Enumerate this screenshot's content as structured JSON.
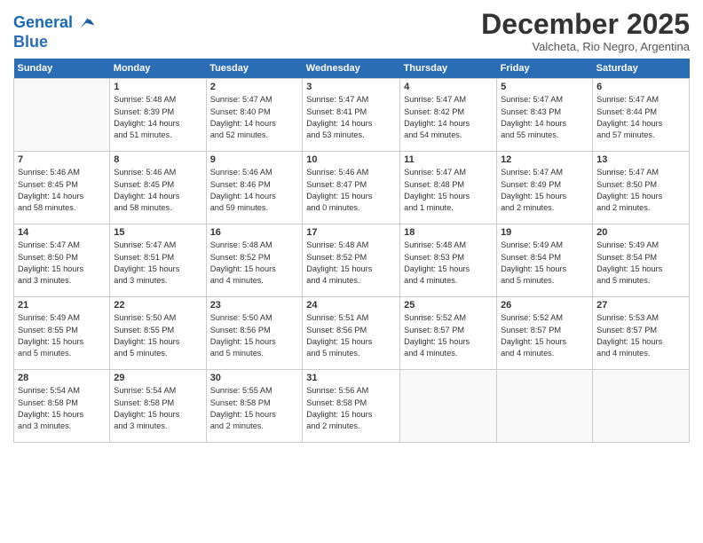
{
  "header": {
    "logo_line1": "General",
    "logo_line2": "Blue",
    "month_year": "December 2025",
    "location": "Valcheta, Rio Negro, Argentina"
  },
  "weekdays": [
    "Sunday",
    "Monday",
    "Tuesday",
    "Wednesday",
    "Thursday",
    "Friday",
    "Saturday"
  ],
  "weeks": [
    [
      {
        "day": "",
        "info": ""
      },
      {
        "day": "1",
        "info": "Sunrise: 5:48 AM\nSunset: 8:39 PM\nDaylight: 14 hours\nand 51 minutes."
      },
      {
        "day": "2",
        "info": "Sunrise: 5:47 AM\nSunset: 8:40 PM\nDaylight: 14 hours\nand 52 minutes."
      },
      {
        "day": "3",
        "info": "Sunrise: 5:47 AM\nSunset: 8:41 PM\nDaylight: 14 hours\nand 53 minutes."
      },
      {
        "day": "4",
        "info": "Sunrise: 5:47 AM\nSunset: 8:42 PM\nDaylight: 14 hours\nand 54 minutes."
      },
      {
        "day": "5",
        "info": "Sunrise: 5:47 AM\nSunset: 8:43 PM\nDaylight: 14 hours\nand 55 minutes."
      },
      {
        "day": "6",
        "info": "Sunrise: 5:47 AM\nSunset: 8:44 PM\nDaylight: 14 hours\nand 57 minutes."
      }
    ],
    [
      {
        "day": "7",
        "info": "Sunrise: 5:46 AM\nSunset: 8:45 PM\nDaylight: 14 hours\nand 58 minutes."
      },
      {
        "day": "8",
        "info": "Sunrise: 5:46 AM\nSunset: 8:45 PM\nDaylight: 14 hours\nand 58 minutes."
      },
      {
        "day": "9",
        "info": "Sunrise: 5:46 AM\nSunset: 8:46 PM\nDaylight: 14 hours\nand 59 minutes."
      },
      {
        "day": "10",
        "info": "Sunrise: 5:46 AM\nSunset: 8:47 PM\nDaylight: 15 hours\nand 0 minutes."
      },
      {
        "day": "11",
        "info": "Sunrise: 5:47 AM\nSunset: 8:48 PM\nDaylight: 15 hours\nand 1 minute."
      },
      {
        "day": "12",
        "info": "Sunrise: 5:47 AM\nSunset: 8:49 PM\nDaylight: 15 hours\nand 2 minutes."
      },
      {
        "day": "13",
        "info": "Sunrise: 5:47 AM\nSunset: 8:50 PM\nDaylight: 15 hours\nand 2 minutes."
      }
    ],
    [
      {
        "day": "14",
        "info": "Sunrise: 5:47 AM\nSunset: 8:50 PM\nDaylight: 15 hours\nand 3 minutes."
      },
      {
        "day": "15",
        "info": "Sunrise: 5:47 AM\nSunset: 8:51 PM\nDaylight: 15 hours\nand 3 minutes."
      },
      {
        "day": "16",
        "info": "Sunrise: 5:48 AM\nSunset: 8:52 PM\nDaylight: 15 hours\nand 4 minutes."
      },
      {
        "day": "17",
        "info": "Sunrise: 5:48 AM\nSunset: 8:52 PM\nDaylight: 15 hours\nand 4 minutes."
      },
      {
        "day": "18",
        "info": "Sunrise: 5:48 AM\nSunset: 8:53 PM\nDaylight: 15 hours\nand 4 minutes."
      },
      {
        "day": "19",
        "info": "Sunrise: 5:49 AM\nSunset: 8:54 PM\nDaylight: 15 hours\nand 5 minutes."
      },
      {
        "day": "20",
        "info": "Sunrise: 5:49 AM\nSunset: 8:54 PM\nDaylight: 15 hours\nand 5 minutes."
      }
    ],
    [
      {
        "day": "21",
        "info": "Sunrise: 5:49 AM\nSunset: 8:55 PM\nDaylight: 15 hours\nand 5 minutes."
      },
      {
        "day": "22",
        "info": "Sunrise: 5:50 AM\nSunset: 8:55 PM\nDaylight: 15 hours\nand 5 minutes."
      },
      {
        "day": "23",
        "info": "Sunrise: 5:50 AM\nSunset: 8:56 PM\nDaylight: 15 hours\nand 5 minutes."
      },
      {
        "day": "24",
        "info": "Sunrise: 5:51 AM\nSunset: 8:56 PM\nDaylight: 15 hours\nand 5 minutes."
      },
      {
        "day": "25",
        "info": "Sunrise: 5:52 AM\nSunset: 8:57 PM\nDaylight: 15 hours\nand 4 minutes."
      },
      {
        "day": "26",
        "info": "Sunrise: 5:52 AM\nSunset: 8:57 PM\nDaylight: 15 hours\nand 4 minutes."
      },
      {
        "day": "27",
        "info": "Sunrise: 5:53 AM\nSunset: 8:57 PM\nDaylight: 15 hours\nand 4 minutes."
      }
    ],
    [
      {
        "day": "28",
        "info": "Sunrise: 5:54 AM\nSunset: 8:58 PM\nDaylight: 15 hours\nand 3 minutes."
      },
      {
        "day": "29",
        "info": "Sunrise: 5:54 AM\nSunset: 8:58 PM\nDaylight: 15 hours\nand 3 minutes."
      },
      {
        "day": "30",
        "info": "Sunrise: 5:55 AM\nSunset: 8:58 PM\nDaylight: 15 hours\nand 2 minutes."
      },
      {
        "day": "31",
        "info": "Sunrise: 5:56 AM\nSunset: 8:58 PM\nDaylight: 15 hours\nand 2 minutes."
      },
      {
        "day": "",
        "info": ""
      },
      {
        "day": "",
        "info": ""
      },
      {
        "day": "",
        "info": ""
      }
    ]
  ]
}
